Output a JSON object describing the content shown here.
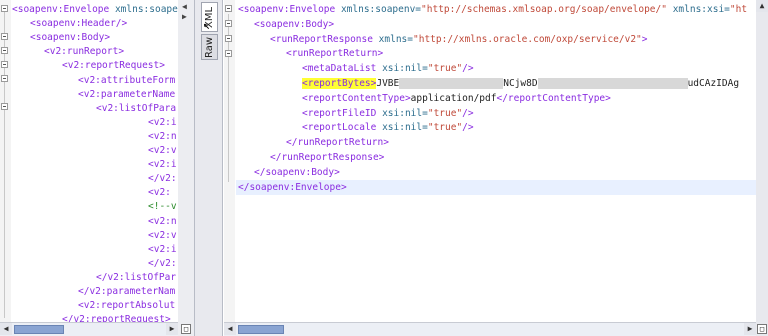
{
  "left_pane": {
    "lines": [
      {
        "parts": [
          {
            "c": "tag",
            "t": "<soapenv:Envelope"
          },
          {
            "c": "attr",
            "t": " xmlns:soape"
          }
        ]
      },
      {
        "parts": [
          {
            "c": "tag",
            "t": "<soapenv:Header/>"
          }
        ]
      },
      {
        "parts": [
          {
            "c": "tag",
            "t": "<soapenv:Body>"
          }
        ]
      },
      {
        "parts": [
          {
            "c": "tag",
            "t": "<v2:runReport>"
          }
        ]
      },
      {
        "parts": [
          {
            "c": "tag",
            "t": "<v2:reportRequest>"
          }
        ]
      },
      {
        "parts": [
          {
            "c": "tag",
            "t": "<v2:attributeForm"
          }
        ]
      },
      {
        "parts": [
          {
            "c": "tag",
            "t": "<v2:parameterName"
          }
        ]
      },
      {
        "parts": [
          {
            "c": "tag",
            "t": "<v2:listOfPara"
          }
        ]
      },
      {
        "parts": [
          {
            "c": "tag",
            "t": "<v2:i"
          }
        ]
      },
      {
        "parts": [
          {
            "c": "tag",
            "t": "<v2:n"
          }
        ]
      },
      {
        "parts": [
          {
            "c": "tag",
            "t": "<v2:v"
          }
        ]
      },
      {
        "parts": [
          {
            "c": "tag",
            "t": "<v2:i"
          }
        ]
      },
      {
        "parts": [
          {
            "c": "tag",
            "t": "</v2:"
          }
        ]
      },
      {
        "parts": [
          {
            "c": "tag",
            "t": "<v2:"
          }
        ]
      },
      {
        "parts": [
          {
            "c": "cm",
            "t": "<!--v"
          }
        ]
      },
      {
        "parts": [
          {
            "c": "tag",
            "t": "<v2:n"
          }
        ]
      },
      {
        "parts": [
          {
            "c": "tag",
            "t": "<v2:v"
          }
        ]
      },
      {
        "parts": [
          {
            "c": "tag",
            "t": "<v2:i"
          }
        ]
      },
      {
        "parts": [
          {
            "c": "tag",
            "t": "</v2:"
          }
        ]
      },
      {
        "parts": [
          {
            "c": "tag",
            "t": "</v2:listOfPar"
          }
        ]
      },
      {
        "parts": [
          {
            "c": "tag",
            "t": "</v2:parameterNam"
          }
        ]
      },
      {
        "parts": [
          {
            "c": "tag",
            "t": "<v2:reportAbsolut"
          }
        ]
      },
      {
        "parts": [
          {
            "c": "tag",
            "t": "</v2:reportRequest>"
          }
        ]
      }
    ]
  },
  "tabs": [
    {
      "label": "XML"
    },
    {
      "label": "Raw"
    }
  ],
  "right_pane": {
    "lines": [
      {
        "parts": [
          {
            "c": "tag",
            "t": "<soapenv:Envelope"
          },
          {
            "c": "attr",
            "t": " xmlns:soapenv="
          },
          {
            "c": "aval",
            "t": "\"http://schemas.xmlsoap.org/soap/envelope/\""
          },
          {
            "c": "attr",
            "t": " xmlns:xsi="
          },
          {
            "c": "aval",
            "t": "\"ht"
          }
        ]
      },
      {
        "parts": [
          {
            "c": "tag",
            "t": "<soapenv:Body>"
          }
        ]
      },
      {
        "parts": [
          {
            "c": "tag",
            "t": "<runReportResponse"
          },
          {
            "c": "attr",
            "t": " xmlns="
          },
          {
            "c": "aval",
            "t": "\"http://xmlns.oracle.com/oxp/service/v2\""
          },
          {
            "c": "tag",
            "t": ">"
          }
        ]
      },
      {
        "parts": [
          {
            "c": "tag",
            "t": "<runReportReturn>"
          }
        ]
      },
      {
        "parts": [
          {
            "c": "tag",
            "t": "<metaDataList"
          },
          {
            "c": "attr",
            "t": " xsi:nil="
          },
          {
            "c": "aval",
            "t": "\"true\""
          },
          {
            "c": "tag",
            "t": "/>"
          }
        ]
      },
      {
        "parts": [
          {
            "c": "tag hl",
            "t": "<reportBytes>"
          },
          {
            "c": "txt",
            "t": "JVBE"
          },
          {
            "c": "redact",
            "t": ""
          },
          {
            "c": "txt",
            "t": "NCjw8D"
          },
          {
            "c": "redact2",
            "t": ""
          },
          {
            "c": "txt",
            "t": "udCAzIDAg"
          }
        ]
      },
      {
        "parts": [
          {
            "c": "tag",
            "t": "<reportContentType>"
          },
          {
            "c": "txt",
            "t": "application/pdf"
          },
          {
            "c": "tag",
            "t": "</reportContentType>"
          }
        ]
      },
      {
        "parts": [
          {
            "c": "tag",
            "t": "<reportFileID"
          },
          {
            "c": "attr",
            "t": " xsi:nil="
          },
          {
            "c": "aval",
            "t": "\"true\""
          },
          {
            "c": "tag",
            "t": "/>"
          }
        ]
      },
      {
        "parts": [
          {
            "c": "tag",
            "t": "<reportLocale"
          },
          {
            "c": "attr",
            "t": " xsi:nil="
          },
          {
            "c": "aval",
            "t": "\"true\""
          },
          {
            "c": "tag",
            "t": "/>"
          }
        ]
      },
      {
        "parts": [
          {
            "c": "tag",
            "t": "</runReportReturn>"
          }
        ]
      },
      {
        "parts": [
          {
            "c": "tag",
            "t": "</runReportResponse>"
          }
        ]
      },
      {
        "parts": [
          {
            "c": "tag",
            "t": "</soapenv:Body>"
          }
        ]
      },
      {
        "parts": [
          {
            "c": "tag",
            "t": "</soapenv:Envelope>"
          }
        ]
      }
    ]
  },
  "icons": {
    "collapse": "collapse-left-icon",
    "expand": "expand-right-icon",
    "cursor": "mouse-cursor-icon"
  }
}
